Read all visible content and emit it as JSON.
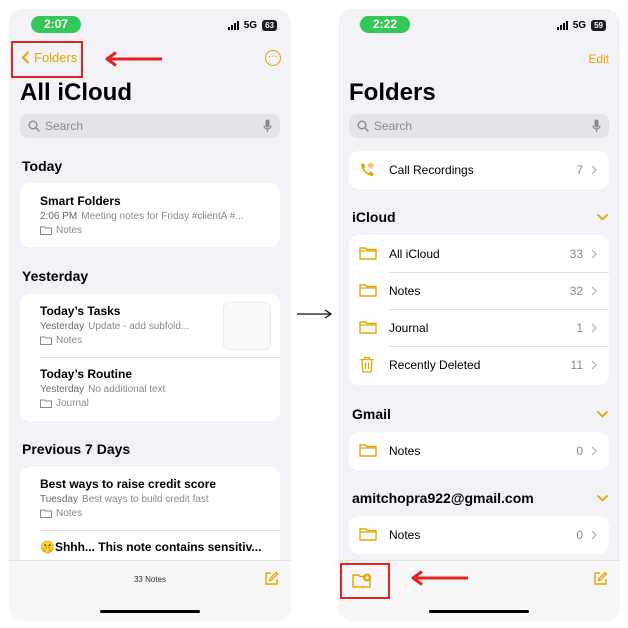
{
  "left": {
    "status": {
      "time": "2:07",
      "network": "5G",
      "battery": "63"
    },
    "nav": {
      "back_label": "Folders",
      "more_icon": "ellipsis-circle-icon"
    },
    "title": "All iCloud",
    "search": {
      "placeholder": "Search"
    },
    "sections": {
      "today": "Today",
      "yesterday": "Yesterday",
      "prev7": "Previous 7 Days"
    },
    "notes": [
      {
        "title": "Smart Folders",
        "date": "2:06 PM",
        "preview": "Meeting notes for Friday #clientA #...",
        "folder": "Notes"
      },
      {
        "title": "Today’s Tasks",
        "date": "Yesterday",
        "preview": "Update - add subfold...",
        "folder": "Notes"
      },
      {
        "title": "Today’s Routine",
        "date": "Yesterday",
        "preview": "No additional text",
        "folder": "Journal"
      },
      {
        "title": "Best ways to raise credit score",
        "date": "Tuesday",
        "preview": "Best ways to build credit fast",
        "folder": "Notes"
      },
      {
        "title": "🤫Shhh... This note contains sensitiv..."
      }
    ],
    "footer": {
      "count": "33 Notes"
    }
  },
  "right": {
    "status": {
      "time": "2:22",
      "network": "5G",
      "battery": "59"
    },
    "nav": {
      "edit_label": "Edit"
    },
    "title": "Folders",
    "search": {
      "placeholder": "Search"
    },
    "call_recordings": {
      "label": "Call Recordings",
      "count": "7"
    },
    "groups": {
      "icloud": {
        "name": "iCloud",
        "folders": [
          {
            "label": "All iCloud",
            "count": "33"
          },
          {
            "label": "Notes",
            "count": "32"
          },
          {
            "label": "Journal",
            "count": "1"
          },
          {
            "label": "Recently Deleted",
            "count": "11"
          }
        ]
      },
      "gmail": {
        "name": "Gmail",
        "folders": [
          {
            "label": "Notes",
            "count": "0"
          }
        ]
      },
      "amit": {
        "name": "amitchopra922@gmail.com",
        "folders": [
          {
            "label": "Notes",
            "count": "0"
          }
        ]
      }
    }
  },
  "colors": {
    "accent": "#e5a500",
    "annotation": "#e02424",
    "status_pill": "#34c759"
  }
}
